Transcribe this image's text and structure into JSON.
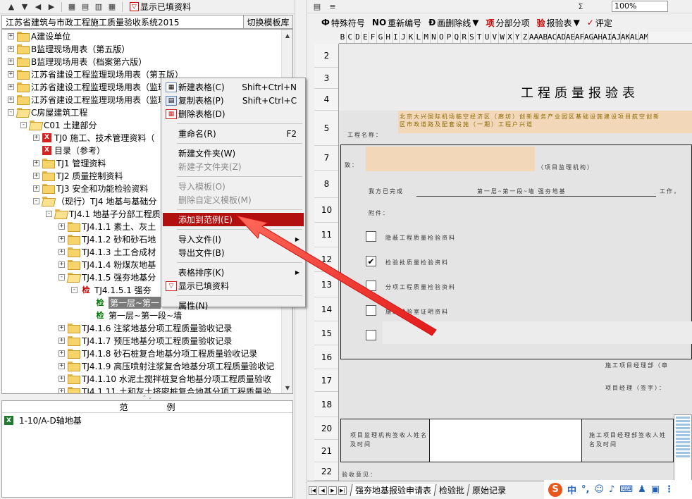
{
  "left_toolbar": {
    "show_filled": "显示已填资料"
  },
  "tree_header": {
    "title": "江苏省建筑与市政工程施工质量验收系统2015",
    "switch_button": "切换模板库"
  },
  "tree_nodes": [
    {
      "label": "A建设单位",
      "expander": "+",
      "icon": "folder"
    },
    {
      "label": "B监理现场用表（第五版）",
      "expander": "+",
      "icon": "folder"
    },
    {
      "label": "B监理现场用表（档案第六版）",
      "expander": "+",
      "icon": "folder"
    },
    {
      "label": "江苏省建设工程监理现场用表（第五版）",
      "expander": "+",
      "icon": "folder"
    },
    {
      "label": "江苏省建设工程监理现场用表（监理",
      "expander": "+",
      "icon": "folder"
    },
    {
      "label": "江苏省建设工程监理现场用表（监理",
      "expander": "+",
      "icon": "folder"
    },
    {
      "label": "C房屋建筑工程",
      "expander": "-",
      "icon": "folder-open"
    },
    {
      "label": "C01 土建部分",
      "expander": "-",
      "icon": "folder-open"
    },
    {
      "label": "TJ0 施工、技术管理资料（",
      "expander": "+",
      "icon": "xls-red"
    },
    {
      "label": "目录（参考）",
      "expander": "",
      "icon": "xls-red"
    },
    {
      "label": "TJ1 管理资料",
      "expander": "+",
      "icon": "folder"
    },
    {
      "label": "TJ2 质量控制资料",
      "expander": "+",
      "icon": "folder"
    },
    {
      "label": "TJ3 安全和功能检验资料",
      "expander": "+",
      "icon": "folder"
    },
    {
      "label": "（现行）TJ4 地基与基础分",
      "expander": "-",
      "icon": "folder-open"
    },
    {
      "label": "TJ4.1 地基子分部工程质",
      "expander": "-",
      "icon": "folder-open"
    },
    {
      "label": "TJ4.1.1 素土、灰土",
      "expander": "+",
      "icon": "folder"
    },
    {
      "label": "TJ4.1.2 砂和砂石地",
      "expander": "+",
      "icon": "folder"
    },
    {
      "label": "TJ4.1.3 土工合成材",
      "expander": "+",
      "icon": "folder"
    },
    {
      "label": "TJ4.1.4 粉煤灰地基",
      "expander": "+",
      "icon": "folder"
    },
    {
      "label": "TJ4.1.5 强夯地基分",
      "expander": "-",
      "icon": "folder-open"
    },
    {
      "label": "TJ4.1.5.1 强夯",
      "expander": "-",
      "icon": "jian-red",
      "icon_text": "检"
    },
    {
      "label": "第一层~第一",
      "expander": "",
      "icon": "jian-green",
      "icon_text": "检",
      "selected": true
    },
    {
      "label": "第一层~第一段~墙",
      "expander": "",
      "icon": "jian-green",
      "icon_text": "检"
    },
    {
      "label": "TJ4.1.6 注浆地基分项工程质量验收记录",
      "expander": "+",
      "icon": "folder"
    },
    {
      "label": "TJ4.1.7 预压地基分项工程质量验收记录",
      "expander": "+",
      "icon": "folder"
    },
    {
      "label": "TJ4.1.8 砂石桩复合地基分项工程质量验收记录",
      "expander": "+",
      "icon": "folder"
    },
    {
      "label": "TJ4.1.9 高压喷射注浆复合地基分项工程质量验收记",
      "expander": "+",
      "icon": "folder"
    },
    {
      "label": "TJ4.1.10 水泥土搅拌桩复合地基分项工程质量验收",
      "expander": "+",
      "icon": "folder"
    },
    {
      "label": "TJ4.1.11 土和灰土挤密桩复合地基分项工程质量验",
      "expander": "+",
      "icon": "folder"
    }
  ],
  "example_panel": {
    "header": "范例",
    "items": [
      {
        "label": "1-10/A-D轴地基",
        "icon": "xls-green"
      }
    ]
  },
  "context_menu": {
    "items": [
      {
        "label": "新建表格(C)",
        "shortcut": "Shift+Ctrl+N",
        "icon": "new-sheet-icon",
        "enabled": true
      },
      {
        "label": "复制表格(P)",
        "shortcut": "Shift+Ctrl+C",
        "icon": "copy-sheet-icon",
        "enabled": true
      },
      {
        "label": "删除表格(D)",
        "shortcut": "",
        "icon": "delete-sheet-icon",
        "enabled": true
      },
      {
        "separator": true
      },
      {
        "label": "重命名(R)",
        "shortcut": "F2",
        "enabled": true
      },
      {
        "separator": true
      },
      {
        "label": "新建文件夹(W)",
        "shortcut": "",
        "enabled": true
      },
      {
        "label": "新建子文件夹(Z)",
        "shortcut": "",
        "enabled": false
      },
      {
        "separator": true
      },
      {
        "label": "导入模板(O)",
        "shortcut": "",
        "enabled": false
      },
      {
        "label": "删除自定义模板(M)",
        "shortcut": "",
        "enabled": false
      },
      {
        "separator": true
      },
      {
        "label": "添加到范例(E)",
        "shortcut": "",
        "enabled": true,
        "highlighted": true
      },
      {
        "separator": true
      },
      {
        "label": "导入文件(I)",
        "submenu": true,
        "enabled": true
      },
      {
        "label": "导出文件(B)",
        "submenu": true,
        "enabled": true
      },
      {
        "separator": true
      },
      {
        "label": "表格排序(K)",
        "submenu": true,
        "enabled": true
      },
      {
        "label": "显示已填资料",
        "icon": "filter-icon",
        "enabled": true
      },
      {
        "separator": true
      },
      {
        "label": "属性(N)",
        "shortcut": "",
        "enabled": true
      }
    ]
  },
  "right_toolbar": {
    "zoom": "100%",
    "sigma": "Σ",
    "buttons": [
      {
        "icon": "Ф",
        "label": "特殊符号"
      },
      {
        "icon": "NO",
        "label": "重新编号"
      },
      {
        "icon": "Ð",
        "label": "画删除线"
      },
      {
        "icon": "项",
        "label": "分部分项"
      },
      {
        "icon": "验",
        "label": "报验表"
      },
      {
        "icon": "✓",
        "label": "评定"
      }
    ]
  },
  "spreadsheet": {
    "columns": [
      "B",
      "C",
      "D",
      "E",
      "F",
      "G",
      "H",
      "I",
      "J",
      "K",
      "L",
      "M",
      "N",
      "O",
      "P",
      "Q",
      "R",
      "S",
      "T",
      "U",
      "V",
      "W",
      "X",
      "Y",
      "Z",
      "AA",
      "AB",
      "AC",
      "AD",
      "AE",
      "AF",
      "AG",
      "AH",
      "AI",
      "AJ",
      "AK",
      "AL",
      "AM"
    ],
    "rows": [
      "2",
      "3",
      "4",
      "5",
      "7",
      "8",
      "10",
      "11",
      "12",
      "13",
      "14",
      "15",
      "16",
      "17",
      "18",
      "20",
      "21",
      "22"
    ],
    "title": "工程质量报验表",
    "project_label": "工程名称：",
    "project_name": "北京大兴国际机场临空经济区（廊坊）创新服务产业园区基础设施建设项目航空创新区市政道路及配套设施（一期）工程户兴道",
    "to_label": "致：",
    "to_right": "（项目监理机构）",
    "completed_label": "我方已完成",
    "completed_value": "第一层~第一段~墙   强夯地基",
    "completed_tail": "工作，",
    "attach_label": "附件：",
    "check_items": [
      {
        "label": "隐蔽工程质量检验资料",
        "checked": false
      },
      {
        "label": "检验批质量检验资料",
        "checked": true
      },
      {
        "label": "分项工程质量检验资料",
        "checked": false
      },
      {
        "label": "施工试验室证明资料",
        "checked": false
      },
      {
        "label": "",
        "checked": false
      }
    ],
    "contractor_dept": "施工项目经理部（章",
    "project_manager": "项目经理（签字）：",
    "sup_receive": "项目监理机构签收人姓名及时间",
    "contractor_receive": "施工项目经理部签收人姓名及时间",
    "inspection_opinion": "验收意见："
  },
  "sheet_tabs": [
    "强夯地基报验申请表",
    "检验批",
    "原始记录"
  ],
  "ime": {
    "logo": "S",
    "mode": "中",
    "punct": "°,"
  }
}
